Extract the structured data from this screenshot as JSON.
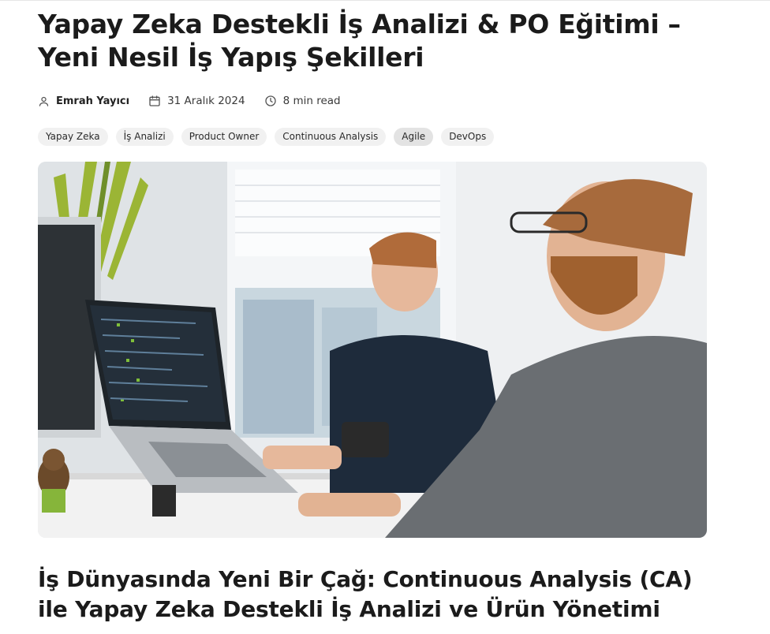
{
  "article": {
    "title": "Yapay Zeka Destekli İş Analizi & PO Eğitimi – Yeni Nesil İş Yapış Şekilleri",
    "meta": {
      "author": "Emrah Yayıcı",
      "author_icon": "user-icon",
      "date": "31 Aralık 2024",
      "date_icon": "calendar-icon",
      "read_time": "8 min read",
      "read_time_icon": "clock-icon"
    },
    "tags": [
      "Yapay Zeka",
      "İş Analizi",
      "Product Owner",
      "Continuous Analysis",
      "Agile",
      "DevOps"
    ],
    "hero_image": {
      "alt": "Two developers working at laptops in a bright office"
    },
    "section_heading": "İş Dünyasında Yeni Bir Çağ: Continuous Analysis (CA) ile Yapay Zeka Destekli İş Analizi ve Ürün Yönetimi"
  }
}
